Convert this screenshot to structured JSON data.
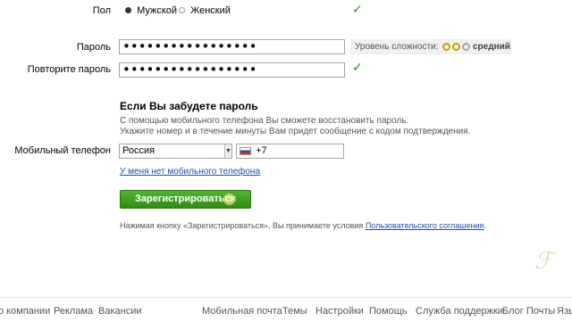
{
  "gender": {
    "label": "Пол",
    "options": [
      {
        "label": "Мужской",
        "selected": true
      },
      {
        "label": "Женский",
        "selected": false
      }
    ]
  },
  "password": {
    "label": "Пароль",
    "value": "•••••••••••••••••",
    "strength_label": "Уровень сложности:",
    "strength_value": "средний"
  },
  "confirm": {
    "label": "Повторите пароль",
    "value": "•••••••••••••••••"
  },
  "recovery": {
    "heading": "Если Вы забудете пароль",
    "line1": "С помощью мобильного телефона Вы сможете восстановить пароль.",
    "line2": "Укажите номер и в течение минуты Вам придет сообщение с кодом подтверждения."
  },
  "phone": {
    "label": "Мобильный телефон",
    "country": "Россия",
    "prefix": "+7",
    "no_phone_link": "У меня нет мобильного телефона"
  },
  "register": {
    "button_label": "Зарегистрироваться",
    "terms_text": "Нажимая кнопку «Зарегистрироваться», Вы принимаете условия ",
    "terms_link": "Пользовательского соглашения",
    "terms_end": "."
  },
  "footer": {
    "items": [
      "о компании",
      "Реклама",
      "Вакансии",
      "Мобильная почта",
      "Темы",
      "Настройки",
      "Помощь",
      "Служба поддержки",
      "Блог Почты",
      "Язы"
    ]
  },
  "colors": {
    "accent_green": "#3a8a1e",
    "link_blue": "#1b4fae",
    "button_green": "#3aa01e"
  }
}
